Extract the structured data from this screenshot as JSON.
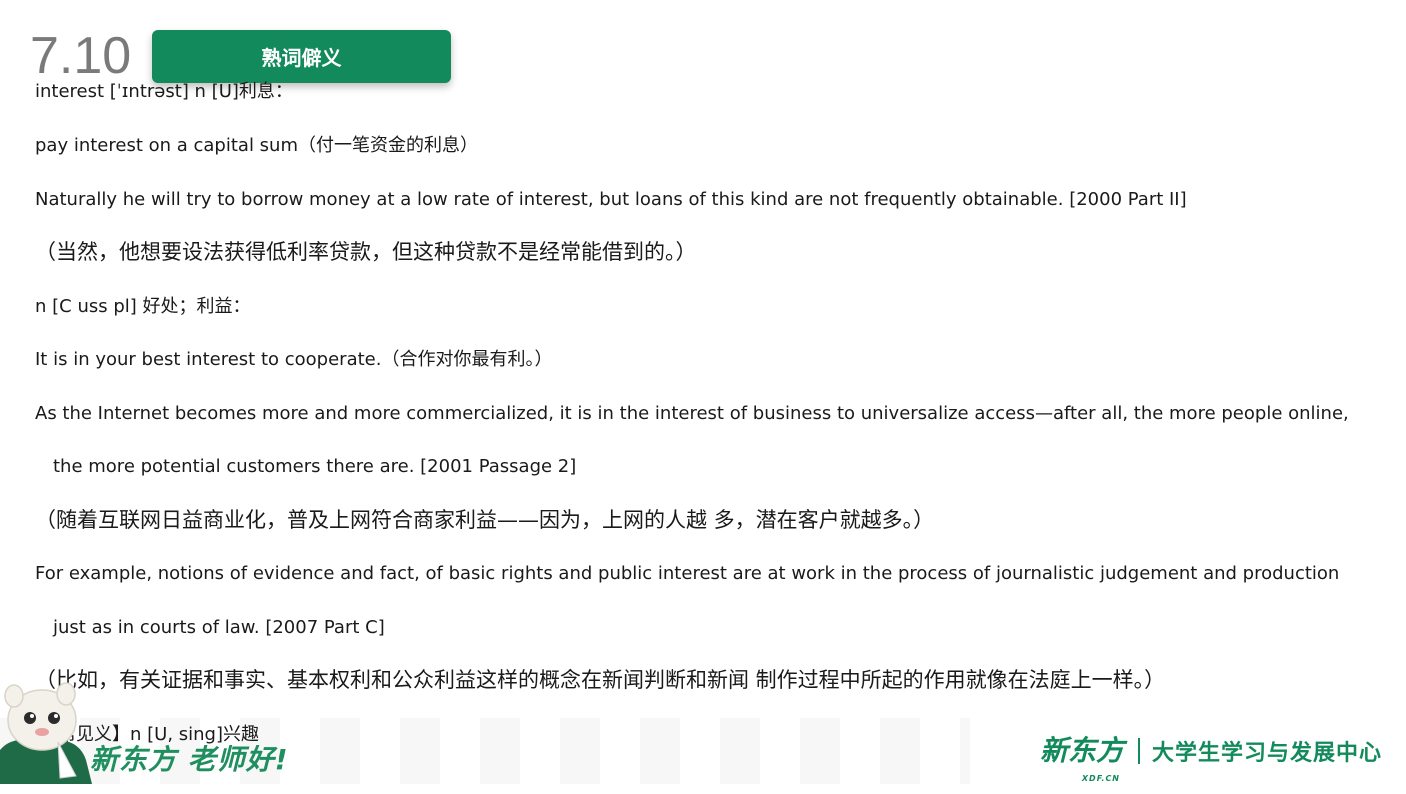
{
  "header": {
    "date": "7.10",
    "title": "熟词僻义"
  },
  "content": {
    "lines": [
      "interest [ˈɪntrəst] n [U]利息：",
      "pay interest on a capital sum（付一笔资金的利息）",
      "Naturally he will try to borrow money at a low rate of interest, but loans of this kind are not frequently obtainable. [2000 Part II]",
      "（当然，他想要设法获得低利率贷款，但这种贷款不是经常能借到的。）",
      "n [C uss pl] 好处；利益：",
      "It is in your best interest to cooperate.（合作对你最有利。）",
      "As the Internet becomes more and more commercialized, it is in the interest of business to universalize access—after all, the more people online,",
      "the more potential customers there are. [2001 Passage 2]",
      "（随着互联网日益商业化，普及上网符合商家利益——因为，上网的人越 多，潜在客户就越多。）",
      "For example, notions of evidence and fact, of basic rights and public interest are at work in the process of journalistic judgement and production",
      "just as in courts of law. [2007 Part C]",
      "（比如，有关证据和事实、基本权利和公众利益这样的概念在新闻判断和新闻 制作过程中所起的作用就像在法庭上一样。）",
      "【常见义】n [U, sing]兴趣"
    ]
  },
  "footer": {
    "greeting": "新东方 老师好!",
    "logo_mark": "新东方",
    "logo_sub": "XDF.CN",
    "logo_text": "大学生学习与发展中心"
  },
  "colors": {
    "accent": "#138a5c",
    "date_gray": "#7a7a7a"
  }
}
